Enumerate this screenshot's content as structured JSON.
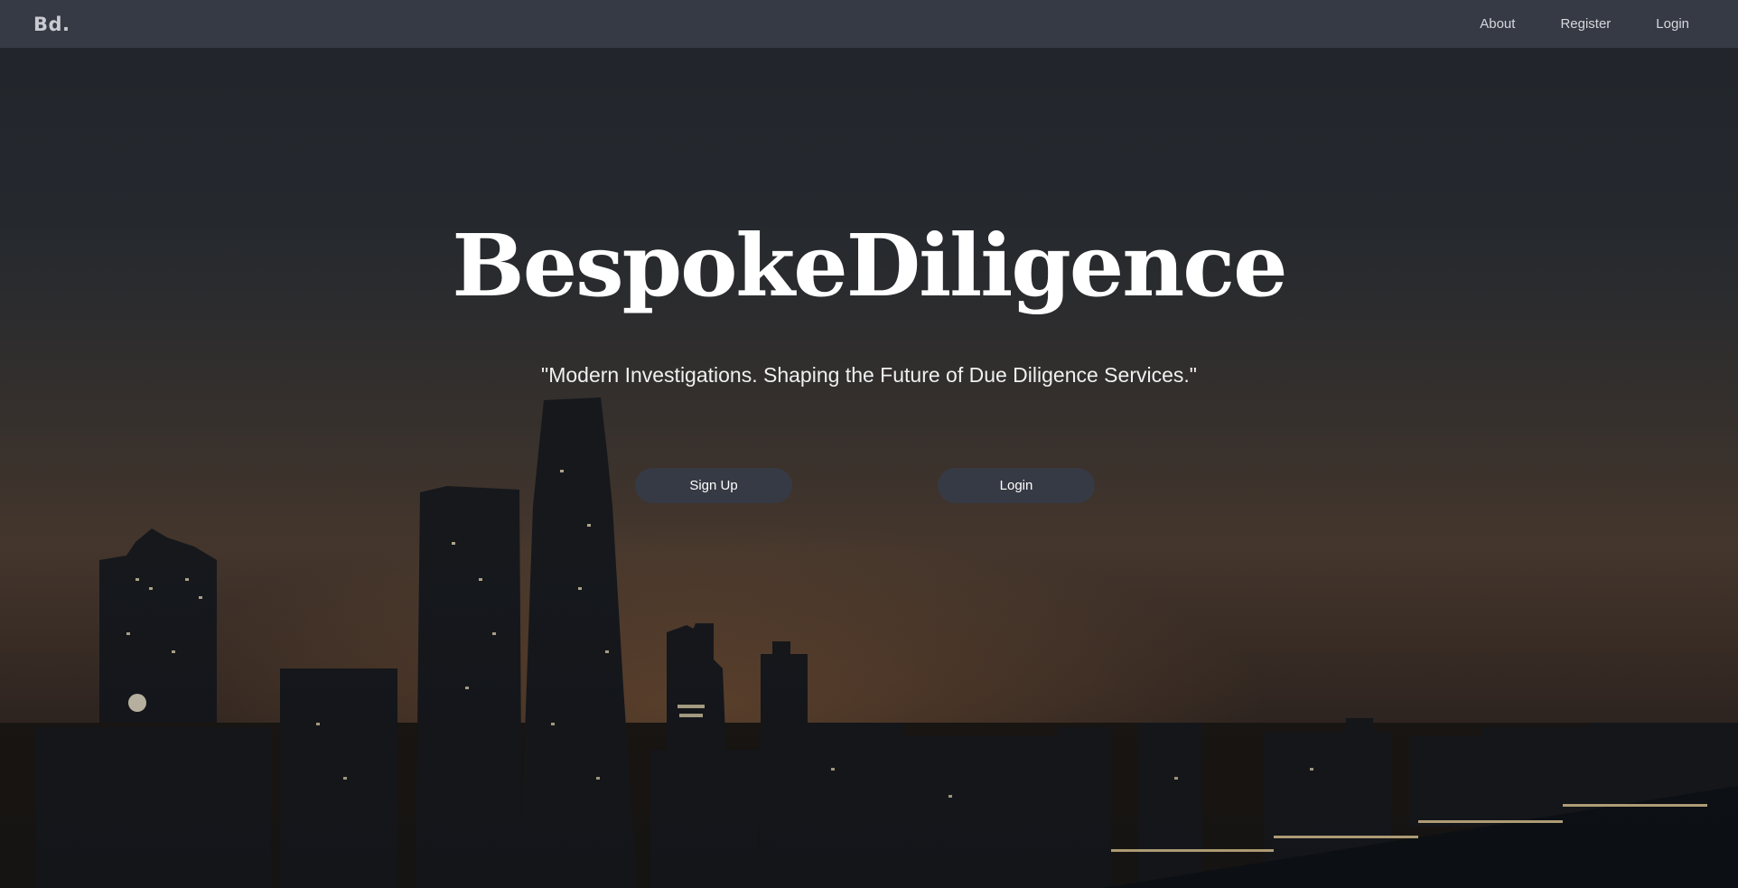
{
  "navbar": {
    "brand": "Bd.",
    "links": [
      {
        "label": "About"
      },
      {
        "label": "Register"
      },
      {
        "label": "Login"
      }
    ]
  },
  "hero": {
    "title": "BespokeDiligence",
    "tagline": "\"Modern Investigations. Shaping the Future of Due Diligence Services.\"",
    "background": "night-city-skyline-image",
    "buttons": {
      "signup": "Sign Up",
      "login": "Login"
    }
  },
  "colors": {
    "navbar_bg": "#363a44",
    "button_bg": "#363a44",
    "text": "#ffffff"
  }
}
